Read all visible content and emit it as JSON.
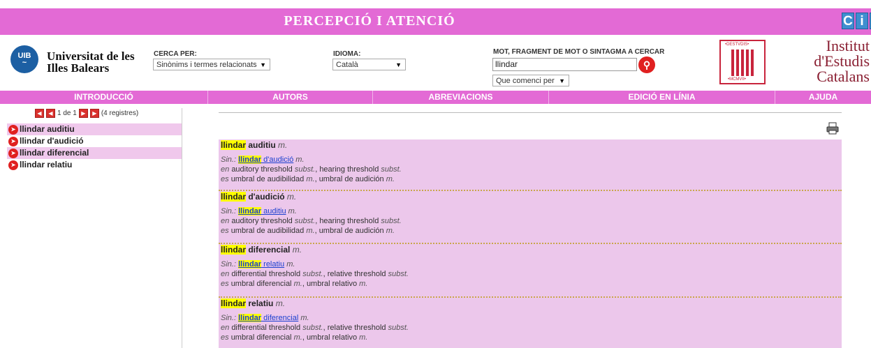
{
  "topbar": {
    "title": "PERCEPCIÓ I ATENCIÓ",
    "cit_logo": [
      "C",
      "i",
      "T"
    ]
  },
  "uib": {
    "logo_text": "UIB",
    "name_line1": "Universitat de les",
    "name_line2": "Illes Balears"
  },
  "search": {
    "cerca_label": "CERCA PER:",
    "cerca_value": "Sinònims i termes relacionats",
    "idioma_label": "IDIOMA:",
    "idioma_value": "Català",
    "mot_label": "MOT, FRAGMENT DE MOT O SINTAGMA A CERCAR",
    "query": "llindar",
    "mode_value": "Que comenci per"
  },
  "iec": {
    "line1": "Institut",
    "line2": "d'Estudis",
    "line3": "Catalans",
    "seal_top": "•DESTVDIS•",
    "seal_bottom": "•MCMVII•"
  },
  "nav": [
    "INTRODUCCIÓ",
    "AUTORS",
    "ABREVIACIONS",
    "EDICIÓ EN LÍNIA",
    "AJUDA"
  ],
  "pager": {
    "page_text": "1 de 1",
    "count_text": "(4 registres)"
  },
  "sidebar_items": [
    "llindar auditiu",
    "llindar d'audició",
    "llindar diferencial",
    "llindar relatiu"
  ],
  "entries": [
    {
      "hl": "llindar",
      "rest": " auditiu",
      "gram": "m.",
      "sin_label": "Sin.:",
      "sin_hl": "llindar",
      "sin_rest": " d'audició",
      "sin_gram": "m.",
      "en_lang": "en",
      "en1": "auditory threshold",
      "en1g": "subst.",
      "en2": "hearing threshold",
      "en2g": "subst.",
      "es_lang": "es",
      "es1": "umbral de audibilidad",
      "es1g": "m.",
      "es2": "umbral de audición",
      "es2g": "m."
    },
    {
      "hl": "llindar",
      "rest": " d'audició",
      "gram": "m.",
      "sin_label": "Sin.:",
      "sin_hl": "llindar",
      "sin_rest": " auditiu",
      "sin_gram": "m.",
      "en_lang": "en",
      "en1": "auditory threshold",
      "en1g": "subst.",
      "en2": "hearing threshold",
      "en2g": "subst.",
      "es_lang": "es",
      "es1": "umbral de audibilidad",
      "es1g": "m.",
      "es2": "umbral de audición",
      "es2g": "m."
    },
    {
      "hl": "llindar",
      "rest": " diferencial",
      "gram": "m.",
      "sin_label": "Sin.:",
      "sin_hl": "llindar",
      "sin_rest": " relatiu",
      "sin_gram": "m.",
      "en_lang": "en",
      "en1": "differential threshold",
      "en1g": "subst.",
      "en2": "relative threshold",
      "en2g": "subst.",
      "es_lang": "es",
      "es1": "umbral diferencial",
      "es1g": "m.",
      "es2": "umbral relativo",
      "es2g": "m."
    },
    {
      "hl": "llindar",
      "rest": " relatiu",
      "gram": "m.",
      "sin_label": "Sin.:",
      "sin_hl": "llindar",
      "sin_rest": " diferencial",
      "sin_gram": "m.",
      "en_lang": "en",
      "en1": "differential threshold",
      "en1g": "subst.",
      "en2": "relative threshold",
      "en2g": "subst.",
      "es_lang": "es",
      "es1": "umbral diferencial",
      "es1g": "m.",
      "es2": "umbral relativo",
      "es2g": "m."
    }
  ],
  "colors": {
    "accent": "#e36ad5",
    "entry_bg": "#ecc7eb",
    "highlight": "#ffff00",
    "link": "#1a3fcf"
  }
}
